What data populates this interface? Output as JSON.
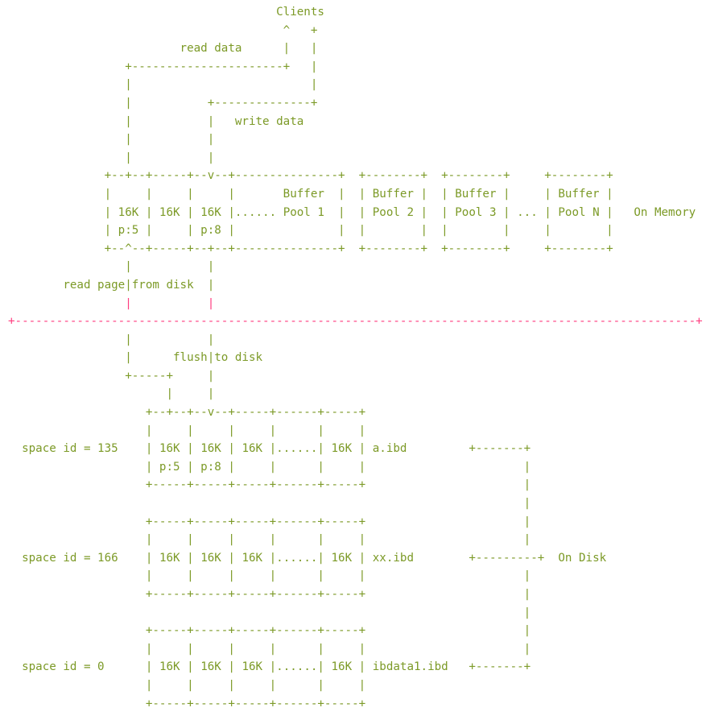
{
  "clients": "Clients",
  "read_data": "read data",
  "write_data": "write data",
  "buffer_pools": [
    {
      "l1": "Buffer",
      "l2": "Pool 1"
    },
    {
      "l1": "Buffer",
      "l2": "Pool 2"
    },
    {
      "l1": "Buffer",
      "l2": "Pool 3"
    },
    {
      "l1": "Buffer",
      "l2": "Pool N"
    }
  ],
  "pools_ellipsis": "...",
  "memory_pages": [
    {
      "size": "16K",
      "page": "p:5"
    },
    {
      "size": "16K",
      "page": ""
    },
    {
      "size": "16K",
      "page": "p:8"
    }
  ],
  "page_gap": "......",
  "on_memory": "On Memory",
  "read_page": "read page",
  "from_disk": "from disk",
  "flush": "flush",
  "to_disk": "to disk",
  "tablespaces": [
    {
      "label": "space id = 135",
      "file": "a.ibd",
      "pages": [
        "16K",
        "16K",
        "16K",
        "16K"
      ],
      "page_nos": [
        "p:5",
        "p:8"
      ]
    },
    {
      "label": "space id = 166",
      "file": "xx.ibd",
      "pages": [
        "16K",
        "16K",
        "16K",
        "16K"
      ]
    },
    {
      "label": "space id = 0",
      "file": "ibdata1.ibd",
      "pages": [
        "16K",
        "16K",
        "16K",
        "16K"
      ]
    }
  ],
  "on_disk": "On Disk",
  "colors": {
    "text": "#7c9a27",
    "boundary": "#ff3d7f"
  }
}
